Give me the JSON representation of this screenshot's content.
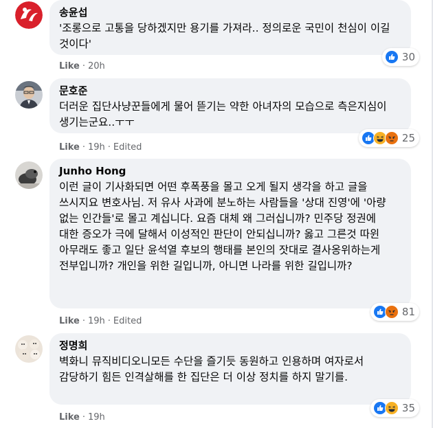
{
  "comments": [
    {
      "name": "송윤섭",
      "text": "'조롱으로 고통을 당하겠지만 용기를 가져라.. 정의로운 국민이 천심이 이길 것이다'",
      "like_label": "Like",
      "time": "20h",
      "edited": "",
      "reactions": [
        "like"
      ],
      "reaction_count": "30"
    },
    {
      "name": "문호준",
      "text": "더러운 집단사냥꾼들에게 물어 뜯기는 약한 아녀자의 모습으로 측은지심이 생기는군요..ㅜㅜ",
      "like_label": "Like",
      "time": "19h",
      "edited": "Edited",
      "reactions": [
        "like",
        "haha",
        "angry"
      ],
      "reaction_count": "25"
    },
    {
      "name": "Junho Hong",
      "text": "이런 글이 기사화되면 어떤 후폭풍을 몰고 오게 될지 생각을 하고 글을 쓰시지요 변호사님. 저 유사 사과에 분노하는 사람들을 '상대 진영'에 '아량 없는 인간들'로 몰고 계십니다. 요즘 대체 왜 그러십니까? 민주당 정권에 대한 증오가 극에 달해서 이성적인 판단이 안되십니까? 옳고 그른것 따윈 아무래도 좋고 일단 윤석열 후보의 행태를 본인의 잣대로 결사옹위하는게 전부입니까? 개인을 위한 길입니까, 아니면 나라를 위한 길입니까?",
      "like_label": "Like",
      "time": "19h",
      "edited": "Edited",
      "reactions": [
        "like",
        "angry"
      ],
      "reaction_count": "81"
    },
    {
      "name": "정명희",
      "text": "벽화니 뮤직비디오니모든 수단을 즐기듯 동원하고 인용하며 여자로서 감당하기 힘든 인격살해를 한 집단은 더 이상 정치를 하지 말기를.",
      "like_label": "Like",
      "time": "19h",
      "edited": "",
      "reactions": [
        "like",
        "haha"
      ],
      "reaction_count": "35"
    }
  ],
  "colors": {
    "like_blue": "#1877f2",
    "angry_orange": "#e9710f",
    "haha_yellow": "#f7b125",
    "meta_gray": "#65676b",
    "bubble_gray": "#f0f2f5"
  }
}
